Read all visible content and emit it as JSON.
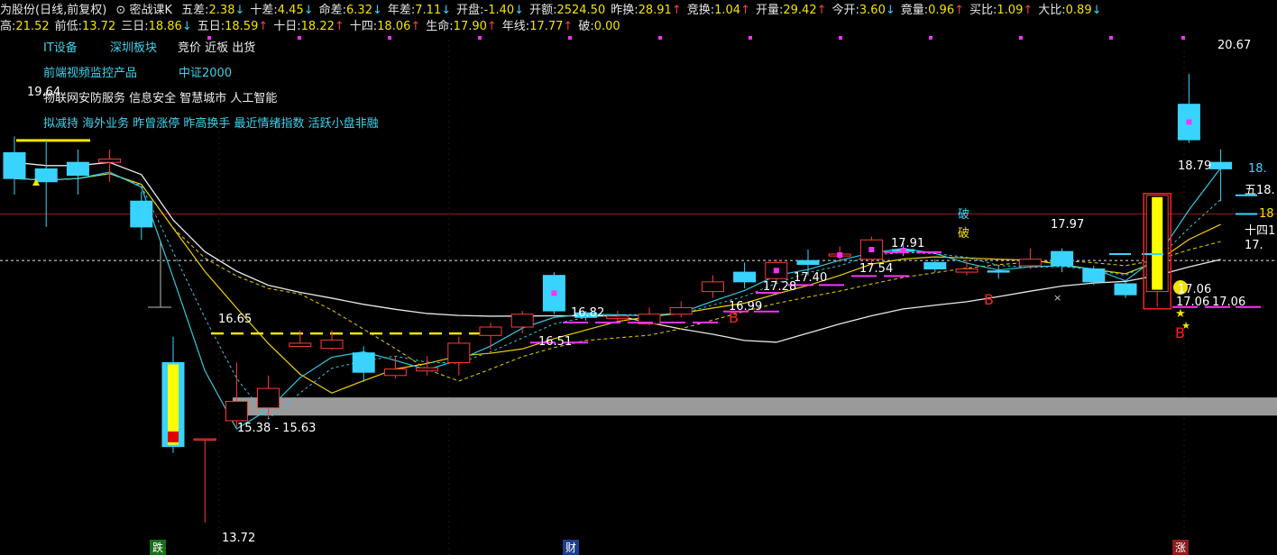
{
  "header": {
    "title": "为股份(日线,前复权)",
    "dropdown_label": "密战课K",
    "row1": [
      {
        "label": "五差:",
        "value": "2.38",
        "dir": "down"
      },
      {
        "label": "十差:",
        "value": "4.45",
        "dir": "down"
      },
      {
        "label": "命差:",
        "value": "6.32",
        "dir": "down"
      },
      {
        "label": "年差:",
        "value": "7.11",
        "dir": "down"
      },
      {
        "label": "开盘:",
        "value": "-1.40",
        "dir": "down"
      },
      {
        "label": "开额:",
        "value": "2524.50",
        "dir": ""
      },
      {
        "label": "昨换:",
        "value": "28.91",
        "dir": "up"
      },
      {
        "label": "竞换:",
        "value": "1.04",
        "dir": "up"
      },
      {
        "label": "开量:",
        "value": "29.42",
        "dir": "up"
      },
      {
        "label": "今开:",
        "value": "3.60",
        "dir": "down"
      },
      {
        "label": "竟量:",
        "value": "0.96",
        "dir": "up"
      },
      {
        "label": "买比:",
        "value": "1.09",
        "dir": "up"
      },
      {
        "label": "大比:",
        "value": "0.89",
        "dir": "down"
      }
    ],
    "row2": [
      {
        "label": "高:",
        "value": "21.52",
        "dir": ""
      },
      {
        "label": "前低:",
        "value": "13.72",
        "dir": ""
      },
      {
        "label": "三日:",
        "value": "18.86",
        "dir": "down"
      },
      {
        "label": "五日:",
        "value": "18.59",
        "dir": "up"
      },
      {
        "label": "十日:",
        "value": "18.22",
        "dir": "up"
      },
      {
        "label": "十四:",
        "value": "18.06",
        "dir": "up"
      },
      {
        "label": "生命:",
        "value": "17.90",
        "dir": "up"
      },
      {
        "label": "年线:",
        "value": "17.77",
        "dir": "up"
      },
      {
        "label": "破:",
        "value": "0.00",
        "dir": ""
      }
    ]
  },
  "concepts": {
    "line1a": "IT设备",
    "line1b": "深圳板块",
    "line1c": "竞价 近板 出货",
    "line2a": "前端视频监控产品",
    "line2b": "中证2000",
    "line3": "物联网安防服务 信息安全 智慧城市 人工智能",
    "line4": "拟减持 海外业务 昨曾涨停 昨高换手 最近情绪指数 活跃小盘非融"
  },
  "price_labels": {
    "hi_left": "19.64",
    "hi_right": "20.67",
    "ma_label": "16.65",
    "range": "15.38 - 15.63",
    "low": "13.72",
    "p1651": "16.51",
    "p1682": "16.82",
    "p1699": "16.99",
    "p1728": "17.28",
    "p1740": "17.40",
    "p1754": "17.54",
    "p1791": "17.91",
    "p1797": "17.97",
    "p1879": "18.79",
    "p1706a": "17.06",
    "p1706b": "17.06",
    "p1706c": "17.06",
    "po1": "破",
    "po2": "破",
    "b1": "B",
    "b2": "B",
    "b3": "B",
    "right_wu": "五18.",
    "right_18": "18",
    "right_18b": "18.",
    "right_si": "十四1",
    "right_17": "17."
  },
  "bottom_markers": {
    "m1": "跌",
    "m2": "财",
    "m3": "涨"
  },
  "colors": {
    "up": "#ff3b3b",
    "down": "#38d4ff",
    "ma_white": "#e8e8e8",
    "ma_yellow": "#f0d000",
    "ma_cyan": "#35c8e0",
    "magenta": "#ff30ff"
  },
  "chart_data": {
    "type": "candlestick",
    "scale": {
      "ymin": 13.5,
      "ymax": 21.2
    },
    "ohlc": [
      {
        "o": 19.45,
        "c": 19.05,
        "h": 19.7,
        "l": 18.8
      },
      {
        "o": 19.2,
        "c": 19.0,
        "h": 19.64,
        "l": 18.3
      },
      {
        "o": 19.3,
        "c": 19.1,
        "h": 19.5,
        "l": 18.8
      },
      {
        "o": 19.3,
        "c": 19.35,
        "h": 19.5,
        "l": 19.0
      },
      {
        "o": 18.7,
        "c": 18.3,
        "h": 18.85,
        "l": 18.1
      },
      {
        "o": 16.2,
        "c": 14.9,
        "h": 16.6,
        "l": 14.8
      },
      {
        "o": 15.0,
        "c": 15.02,
        "h": 15.02,
        "l": 13.72
      },
      {
        "o": 15.3,
        "c": 15.6,
        "h": 16.2,
        "l": 15.2
      },
      {
        "o": 15.5,
        "c": 15.8,
        "h": 16.0,
        "l": 15.35
      },
      {
        "o": 16.45,
        "c": 16.5,
        "h": 16.7,
        "l": 16.45
      },
      {
        "o": 16.42,
        "c": 16.55,
        "h": 16.7,
        "l": 16.4
      },
      {
        "o": 16.35,
        "c": 16.05,
        "h": 16.45,
        "l": 15.9
      },
      {
        "o": 16.0,
        "c": 16.1,
        "h": 16.3,
        "l": 15.95
      },
      {
        "o": 16.07,
        "c": 16.12,
        "h": 16.3,
        "l": 16.0
      },
      {
        "o": 16.2,
        "c": 16.5,
        "h": 16.6,
        "l": 16.0
      },
      {
        "o": 16.62,
        "c": 16.75,
        "h": 16.82,
        "l": 16.4
      },
      {
        "o": 16.75,
        "c": 16.95,
        "h": 17.0,
        "l": 16.65
      },
      {
        "o": 17.55,
        "c": 17.0,
        "h": 17.6,
        "l": 16.95
      },
      {
        "o": 16.97,
        "c": 16.9,
        "h": 17.0,
        "l": 16.85
      },
      {
        "o": 16.88,
        "c": 16.92,
        "h": 17.0,
        "l": 16.8
      },
      {
        "o": 16.8,
        "c": 16.95,
        "h": 17.05,
        "l": 16.78
      },
      {
        "o": 16.95,
        "c": 17.05,
        "h": 17.15,
        "l": 16.9
      },
      {
        "o": 17.3,
        "c": 17.45,
        "h": 17.55,
        "l": 17.2
      },
      {
        "o": 17.6,
        "c": 17.45,
        "h": 17.75,
        "l": 17.35
      },
      {
        "o": 17.5,
        "c": 17.75,
        "h": 17.8,
        "l": 17.45
      },
      {
        "o": 17.78,
        "c": 17.72,
        "h": 17.95,
        "l": 17.55
      },
      {
        "o": 17.85,
        "c": 17.88,
        "h": 18.0,
        "l": 17.75
      },
      {
        "o": 17.8,
        "c": 18.1,
        "h": 18.15,
        "l": 17.7
      },
      {
        "o": 17.95,
        "c": 17.92,
        "h": 18.05,
        "l": 17.85
      },
      {
        "o": 17.75,
        "c": 17.65,
        "h": 17.8,
        "l": 17.6
      },
      {
        "o": 17.6,
        "c": 17.65,
        "h": 17.8,
        "l": 17.55
      },
      {
        "o": 17.62,
        "c": 17.6,
        "h": 17.7,
        "l": 17.5
      },
      {
        "o": 17.7,
        "c": 17.8,
        "h": 17.97,
        "l": 17.65
      },
      {
        "o": 17.92,
        "c": 17.7,
        "h": 17.97,
        "l": 17.6
      },
      {
        "o": 17.65,
        "c": 17.45,
        "h": 17.7,
        "l": 17.4
      },
      {
        "o": 17.42,
        "c": 17.25,
        "h": 17.45,
        "l": 17.2
      },
      {
        "o": 17.3,
        "c": 18.79,
        "h": 18.79,
        "l": 17.06
      },
      {
        "o": 20.2,
        "c": 19.65,
        "h": 20.67,
        "l": 19.6
      },
      {
        "o": 19.3,
        "c": 19.2,
        "h": 19.5,
        "l": 18.7
      }
    ]
  }
}
